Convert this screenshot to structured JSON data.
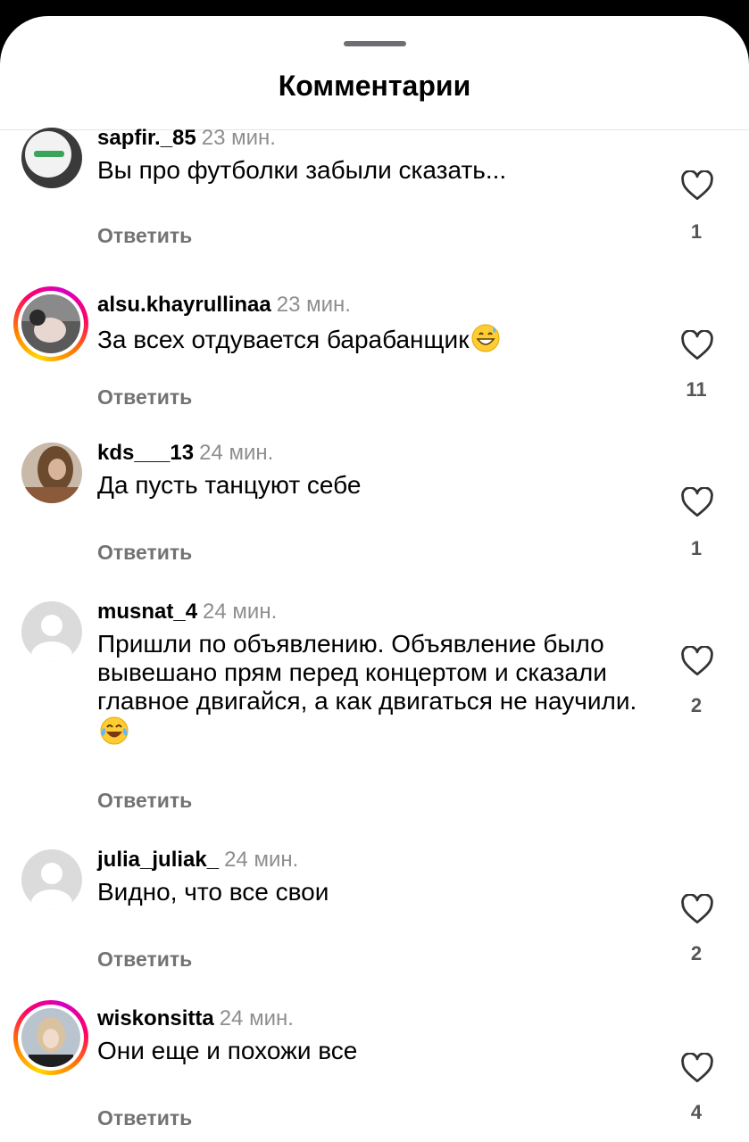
{
  "sheet": {
    "title": "Комментарии"
  },
  "comments": [
    {
      "username": "sapfir._85",
      "time": "23 мин.",
      "text": "Вы про футболки забыли сказать...",
      "emoji": "",
      "reply_label": "Ответить",
      "likes": "1",
      "story_ring": false,
      "avatar": "logo-avatar"
    },
    {
      "username": "alsu.khayrullinaa",
      "time": "23 мин.",
      "text": "За всех отдувается барабанщик",
      "emoji": "grinning-sweat-emoji",
      "reply_label": "Ответить",
      "likes": "11",
      "story_ring": true,
      "avatar": "photo-avatar"
    },
    {
      "username": "kds___13",
      "time": "24 мин.",
      "text": "Да пусть танцуют себе",
      "emoji": "",
      "reply_label": "Ответить",
      "likes": "1",
      "story_ring": false,
      "avatar": "photo-avatar"
    },
    {
      "username": "musnat_4",
      "time": "24 мин.",
      "text": "Пришли по объявлению.  Объявление было вывешано прям перед концертом и сказали главное двигайся, а как двигаться не научили.",
      "emoji": "tears-of-joy-emoji",
      "reply_label": "Ответить",
      "likes": "2",
      "story_ring": false,
      "avatar": "default-avatar"
    },
    {
      "username": "julia_juliak_",
      "time": "24 мин.",
      "text": "Видно, что все свои",
      "emoji": "",
      "reply_label": "Ответить",
      "likes": "2",
      "story_ring": false,
      "avatar": "default-avatar"
    },
    {
      "username": "wiskonsitta",
      "time": "24 мин.",
      "text": "Они еще и похожи все",
      "emoji": "",
      "reply_label": "Ответить",
      "likes": "4",
      "story_ring": true,
      "avatar": "photo-avatar"
    }
  ],
  "colors": {
    "background": "#ffffff",
    "muted": "#8e8e8e",
    "reply": "#737373"
  }
}
